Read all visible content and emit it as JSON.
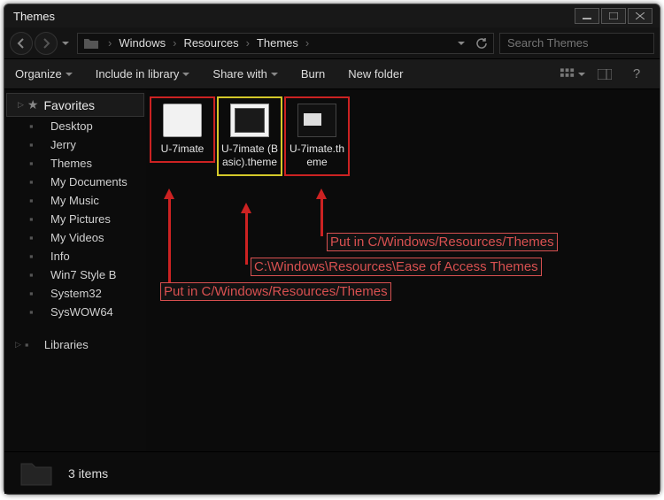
{
  "title": "Themes",
  "breadcrumbs": [
    "Windows",
    "Resources",
    "Themes"
  ],
  "search": {
    "placeholder": "Search Themes"
  },
  "toolbar": {
    "organize": "Organize",
    "include": "Include in library",
    "share": "Share with",
    "burn": "Burn",
    "newfolder": "New folder"
  },
  "sidebar": {
    "favorites": "Favorites",
    "items": [
      "Desktop",
      "Jerry",
      "Themes",
      "My Documents",
      "My Music",
      "My Pictures",
      "My Videos",
      "Info",
      "Win7 Style B",
      "System32",
      "SysWOW64"
    ],
    "libraries": "Libraries"
  },
  "files": [
    {
      "name": "U-7imate",
      "kind": "folder",
      "box": "red"
    },
    {
      "name": "U-7imate (Basic).theme",
      "kind": "theme1",
      "box": "yellow"
    },
    {
      "name": "U-7imate.theme",
      "kind": "theme2",
      "box": "red"
    }
  ],
  "status": "3 items",
  "annotations": {
    "a1": "Put in C/Windows/Resources/Themes",
    "a2": "C:\\Windows\\Resources\\Ease of Access Themes",
    "a3": "Put in C/Windows/Resources/Themes"
  }
}
